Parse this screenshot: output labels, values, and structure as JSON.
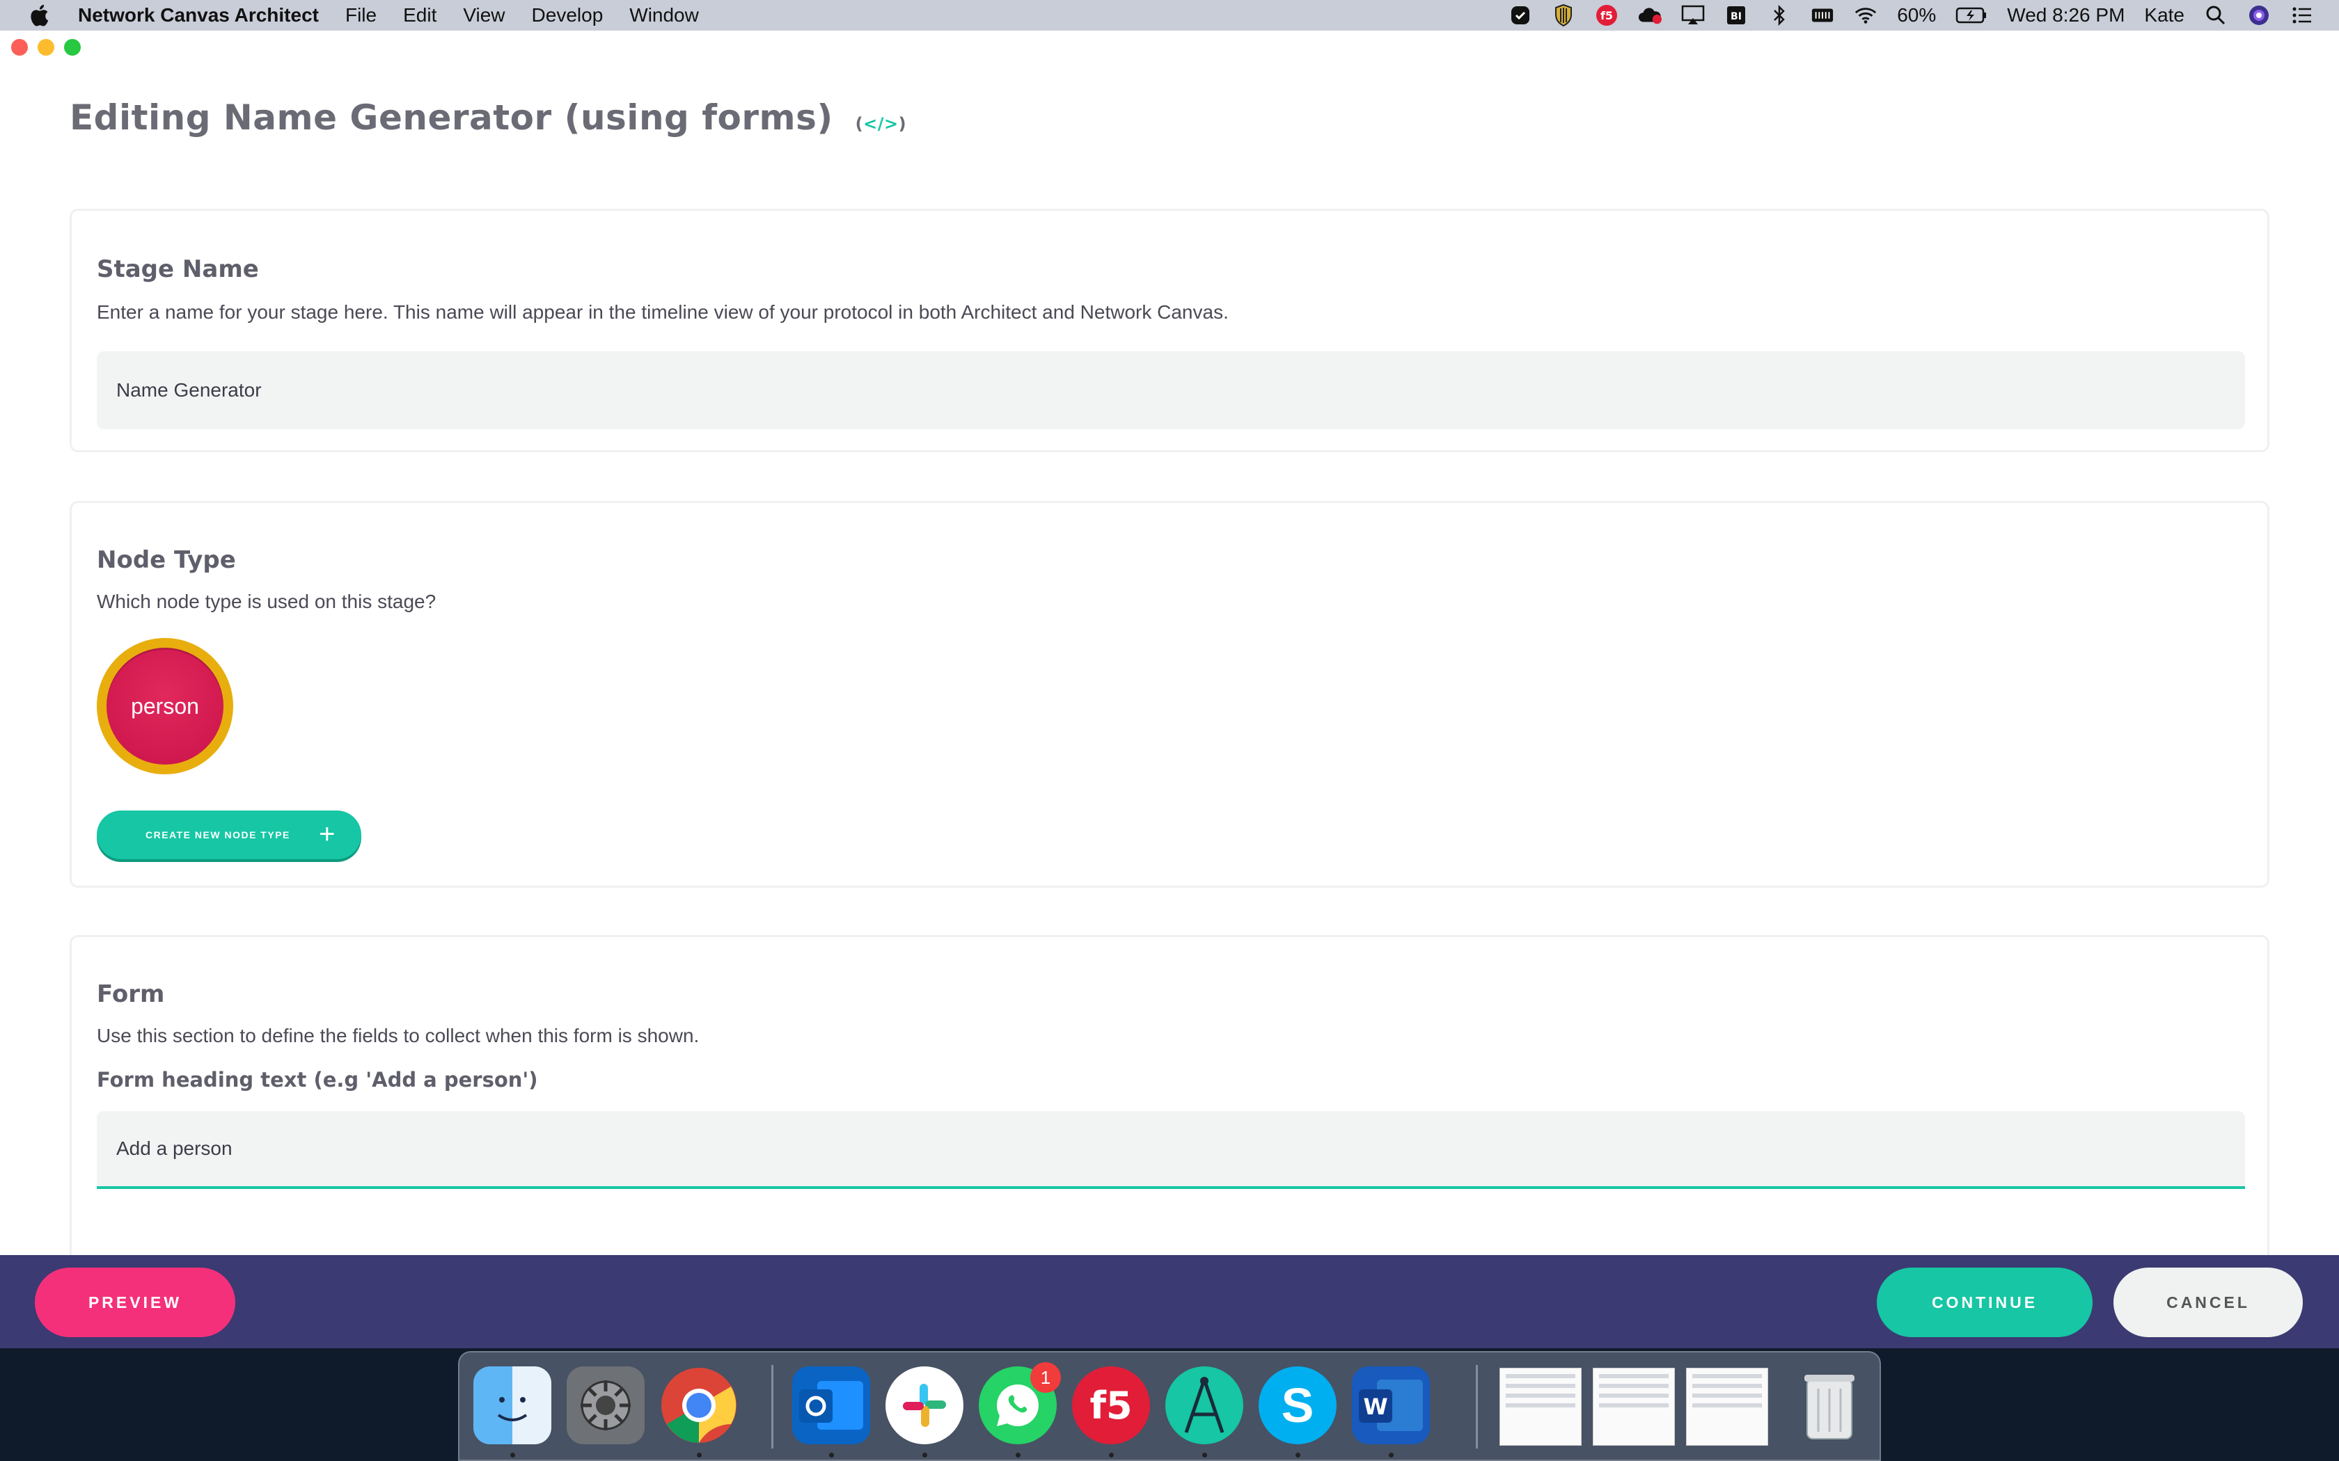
{
  "menubar": {
    "app_name": "Network Canvas Architect",
    "menus": [
      "File",
      "Edit",
      "View",
      "Develop",
      "Window"
    ],
    "battery": "60%",
    "clock": "Wed 8:26 PM",
    "user": "Kate",
    "status_icons": [
      "vpn-check-icon",
      "shield-icon",
      "f5-icon",
      "creative-cloud-icon",
      "airplay-icon",
      "bi-icon",
      "bluetooth-icon",
      "keyboard-icon",
      "wifi-icon",
      "battery-icon",
      "search-icon",
      "siri-icon",
      "control-center-icon"
    ]
  },
  "page": {
    "title": "Editing Name Generator (using forms)",
    "code_toggle": "</>"
  },
  "stage_name": {
    "heading": "Stage Name",
    "description": "Enter a name for your stage here. This name will appear in the timeline view of your protocol in both Architect and Network Canvas.",
    "value": "Name Generator"
  },
  "node_type": {
    "heading": "Node Type",
    "description": "Which node type is used on this stage?",
    "node_label": "person",
    "node_color": "#e2285c",
    "selected_ring_color": "#e8ae0e",
    "create_button": "CREATE NEW NODE TYPE"
  },
  "form": {
    "heading": "Form",
    "description": "Use this section to define the fields to collect when this form is shown.",
    "field_label": "Form heading text (e.g 'Add a person')",
    "value": "Add a person"
  },
  "actions": {
    "preview": "PREVIEW",
    "continue": "CONTINUE",
    "cancel": "CANCEL"
  },
  "dock": {
    "apps": [
      "finder",
      "system-preferences",
      "chrome",
      "outlook",
      "slack",
      "whatsapp",
      "f5",
      "architect",
      "skype",
      "word"
    ],
    "whatsapp_badge": "1",
    "colors": {
      "accent": "#16c6a4",
      "preview": "#f5307a",
      "action_bar": "#3b3a72"
    }
  }
}
